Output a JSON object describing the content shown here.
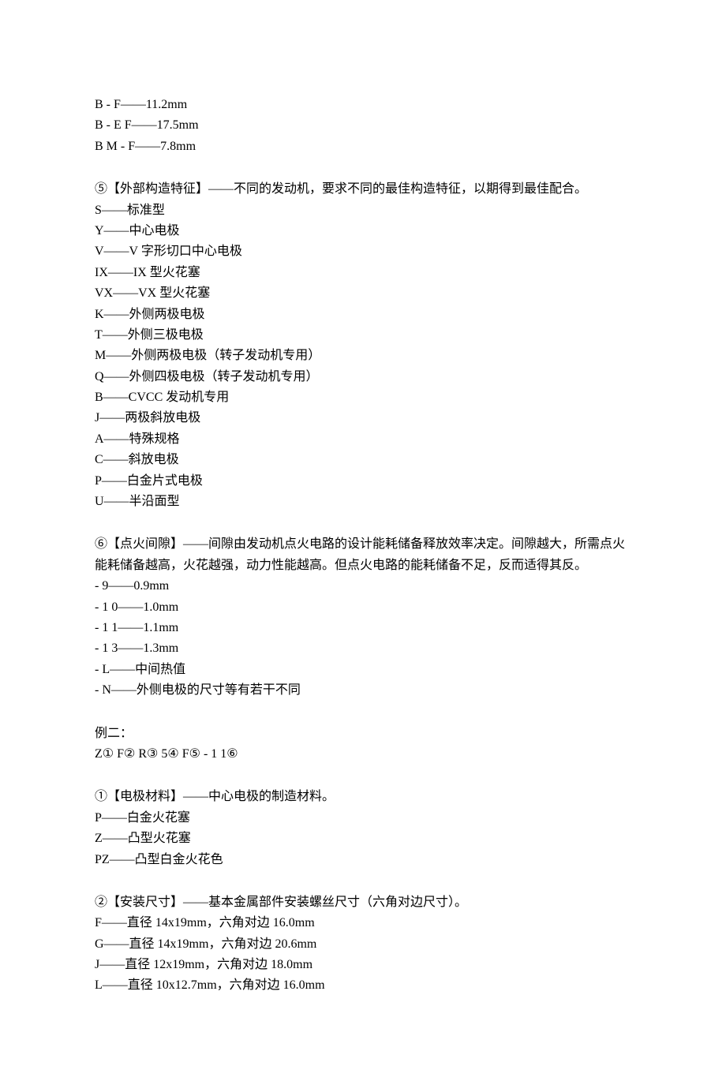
{
  "block1": [
    "B - F——11.2mm",
    "B - E F——17.5mm",
    "B M - F——7.8mm"
  ],
  "section5": {
    "header": "⑤【外部构造特征】——不同的发动机，要求不同的最佳构造特征，以期得到最佳配合。",
    "items": [
      "S——标准型",
      "Y——中心电极",
      "V——V 字形切口中心电极",
      "IX——IX 型火花塞",
      "VX——VX 型火花塞",
      "K——外侧两极电极",
      "T——外侧三极电极",
      "M——外侧两极电极（转子发动机专用）",
      "Q——外侧四极电极（转子发动机专用）",
      "B——CVCC 发动机专用",
      "J——两极斜放电极",
      "A——特殊规格",
      "C——斜放电极",
      "P——白金片式电极",
      "U——半沿面型"
    ]
  },
  "section6": {
    "header": "⑥【点火间隙】——间隙由发动机点火电路的设计能耗储备释放效率决定。间隙越大，所需点火能耗储备越高，火花越强，动力性能越高。但点火电路的能耗储备不足，反而适得其反。",
    "items": [
      "- 9——0.9mm",
      "- 1 0——1.0mm",
      "- 1 1——1.1mm",
      "- 1 3——1.3mm",
      "- L——中间热值",
      "- N——外侧电极的尺寸等有若干不同"
    ]
  },
  "example2": [
    "例二：",
    "",
    "Z① F② R③ 5④ F⑤ - 1 1⑥"
  ],
  "section1b": {
    "header": "①【电极材料】——中心电极的制造材料。",
    "items": [
      "P——白金火花塞",
      "Z——凸型火花塞",
      "PZ——凸型白金火花色"
    ]
  },
  "section2b": {
    "header": "②【安装尺寸】——基本金属部件安装螺丝尺寸（六角对边尺寸）。",
    "items": [
      "F——直径 14x19mm，六角对边 16.0mm",
      "G——直径 14x19mm，六角对边 20.6mm",
      "J——直径 12x19mm，六角对边 18.0mm",
      "L——直径 10x12.7mm，六角对边 16.0mm"
    ]
  }
}
